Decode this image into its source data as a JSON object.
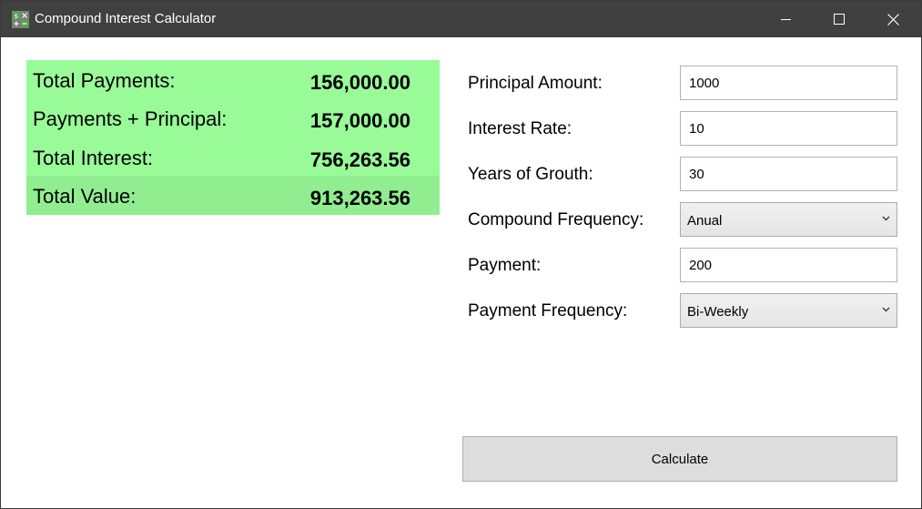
{
  "window": {
    "title": "Compound Interest Calculator",
    "controls": {
      "minimize": "minimize-icon",
      "maximize": "maximize-icon",
      "close": "close-icon"
    }
  },
  "results": {
    "rows": [
      {
        "label": "Total Payments:",
        "value": "156,000.00"
      },
      {
        "label": "Payments + Principal:",
        "value": "157,000.00"
      },
      {
        "label": "Total Interest:",
        "value": "756,263.56"
      },
      {
        "label": "Total Value:",
        "value": "913,263.56"
      }
    ],
    "colors": {
      "background": "#98fb98",
      "total_background": "#90ee90"
    }
  },
  "form": {
    "principal": {
      "label": "Principal Amount:",
      "value": "1000"
    },
    "rate": {
      "label": "Interest Rate:",
      "value": "10"
    },
    "years": {
      "label": "Years of Grouth:",
      "value": "30"
    },
    "compound_frequency": {
      "label": "Compound Frequency:",
      "selected": "Anual"
    },
    "payment": {
      "label": "Payment:",
      "value": "200"
    },
    "payment_frequency": {
      "label": "Payment Frequency:",
      "selected": "Bi-Weekly"
    }
  },
  "actions": {
    "calculate_label": "Calculate"
  },
  "colors": {
    "titlebar": "#404040",
    "window_background": "#ffffff",
    "button_background": "#dddddd"
  }
}
